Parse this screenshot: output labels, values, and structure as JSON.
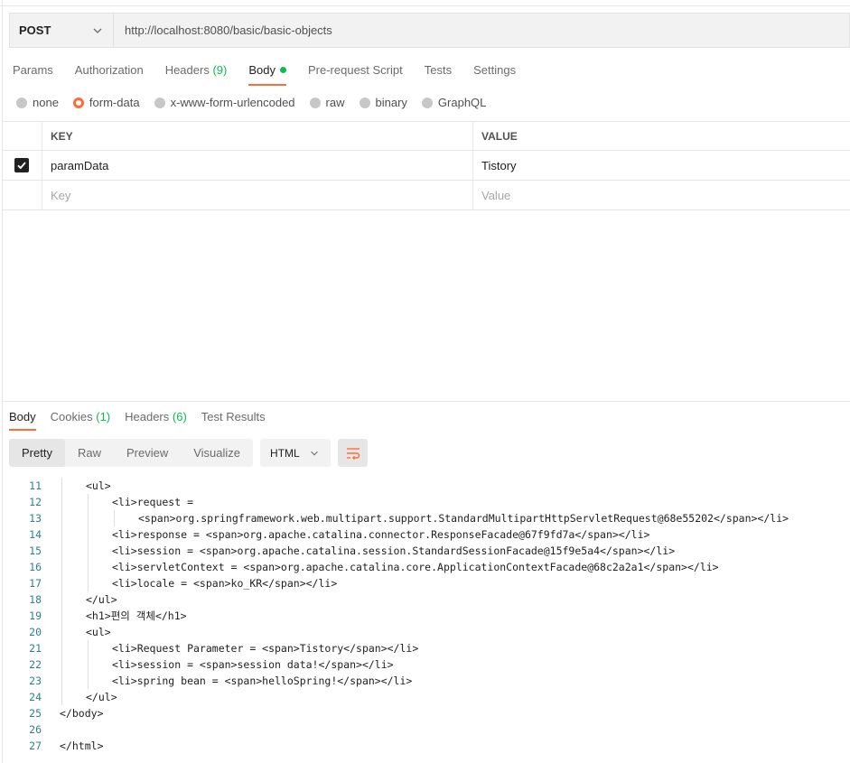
{
  "request": {
    "method": "POST",
    "url": "http://localhost:8080/basic/basic-objects"
  },
  "req_tabs": [
    {
      "label": "Params",
      "count": ""
    },
    {
      "label": "Authorization",
      "count": ""
    },
    {
      "label": "Headers",
      "count": "(9)"
    },
    {
      "label": "Body",
      "count": ""
    },
    {
      "label": "Pre-request Script",
      "count": ""
    },
    {
      "label": "Tests",
      "count": ""
    },
    {
      "label": "Settings",
      "count": ""
    }
  ],
  "body_types": [
    "none",
    "form-data",
    "x-www-form-urlencoded",
    "raw",
    "binary",
    "GraphQL"
  ],
  "selected_body_type": "form-data",
  "kv": {
    "key_header": "KEY",
    "value_header": "VALUE",
    "rows": [
      {
        "key": "paramData",
        "value": "Tistory",
        "checked": true
      }
    ],
    "key_placeholder": "Key",
    "value_placeholder": "Value"
  },
  "resp_tabs": [
    {
      "label": "Body",
      "count": ""
    },
    {
      "label": "Cookies",
      "count": "(1)"
    },
    {
      "label": "Headers",
      "count": "(6)"
    },
    {
      "label": "Test Results",
      "count": ""
    }
  ],
  "view_modes": [
    "Pretty",
    "Raw",
    "Preview",
    "Visualize"
  ],
  "format": "HTML",
  "code_lines": [
    {
      "n": "11",
      "indent": 2,
      "text": "<ul>"
    },
    {
      "n": "12",
      "indent": 3,
      "text": "<li>request ="
    },
    {
      "n": "13",
      "indent": 4,
      "text": "<span>org.springframework.web.multipart.support.StandardMultipartHttpServletRequest@68e55202</span></li>"
    },
    {
      "n": "14",
      "indent": 3,
      "text": "<li>response = <span>org.apache.catalina.connector.ResponseFacade@67f9fd7a</span></li>"
    },
    {
      "n": "15",
      "indent": 3,
      "text": "<li>session = <span>org.apache.catalina.session.StandardSessionFacade@15f9e5a4</span></li>"
    },
    {
      "n": "16",
      "indent": 3,
      "text": "<li>servletContext = <span>org.apache.catalina.core.ApplicationContextFacade@68c2a2a1</span></li>"
    },
    {
      "n": "17",
      "indent": 3,
      "text": "<li>locale = <span>ko_KR</span></li>"
    },
    {
      "n": "18",
      "indent": 2,
      "text": "</ul>"
    },
    {
      "n": "19",
      "indent": 2,
      "text": "<h1>편의 객체</h1>"
    },
    {
      "n": "20",
      "indent": 2,
      "text": "<ul>"
    },
    {
      "n": "21",
      "indent": 3,
      "text": "<li>Request Parameter = <span>Tistory</span></li>"
    },
    {
      "n": "22",
      "indent": 3,
      "text": "<li>session = <span>session data!</span></li>"
    },
    {
      "n": "23",
      "indent": 3,
      "text": "<li>spring bean = <span>helloSpring!</span></li>"
    },
    {
      "n": "24",
      "indent": 2,
      "text": "</ul>"
    },
    {
      "n": "25",
      "indent": 1,
      "text": "</body>"
    },
    {
      "n": "26",
      "indent": 0,
      "text": ""
    },
    {
      "n": "27",
      "indent": 1,
      "text": "</html>"
    }
  ],
  "colors": {
    "accent": "#ff6c37",
    "count": "#0cbb52",
    "line_number": "#2e7d9a"
  }
}
